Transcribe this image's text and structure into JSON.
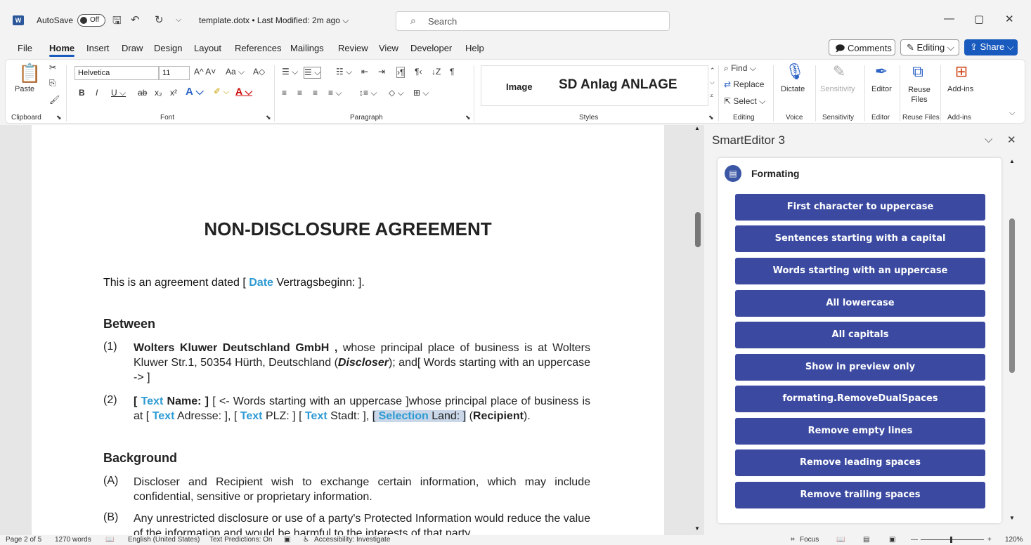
{
  "titlebar": {
    "autosave_label": "AutoSave",
    "autosave_state": "Off",
    "doc_title": "template.dotx • Last Modified: 2m ago ⌵",
    "search_placeholder": "Search"
  },
  "menu": {
    "tabs": [
      "File",
      "Home",
      "Insert",
      "Draw",
      "Design",
      "Layout",
      "References",
      "Mailings",
      "Review",
      "View",
      "Developer",
      "Help"
    ],
    "active": "Home",
    "comments_label": "Comments",
    "editing_label": "Editing ⌵",
    "share_label": "Share ⌵"
  },
  "ribbon": {
    "paste_label": "Paste",
    "clipboard_label": "Clipboard",
    "font_name": "Helvetica",
    "font_size": "11",
    "font_label": "Font",
    "paragraph_label": "Paragraph",
    "styles_label": "Styles",
    "style_image": "Image",
    "style_sd": "SD Anlag ANLAGE",
    "find_label": "Find ⌵",
    "replace_label": "Replace",
    "select_label": "Select ⌵",
    "editing_label": "Editing",
    "dictate_label": "Dictate",
    "voice_label": "Voice",
    "sensitivity_label": "Sensitivity",
    "sensitivity_group": "Sensitivity",
    "editor_label": "Editor",
    "editor_group": "Editor",
    "reuse_label": "Reuse Files",
    "reuse_group": "Reuse Files",
    "addins_label": "Add-ins",
    "addins_group": "Add-ins"
  },
  "document": {
    "heading": "NON-DISCLOSURE AGREEMENT",
    "intro_pre": "This is an agreement dated [ ",
    "intro_field": "Date",
    "intro_post": " Vertragsbeginn: ].",
    "between_heading": "Between",
    "item1_num": "(1)",
    "item1_bold": "Wolters Kluwer Deutschland GmbH ,",
    "item1_text": " whose principal place of business is at Wolters Kluwer Str.1, 50354 Hürth, Deutschland (",
    "item1_discloser": "Discloser",
    "item1_tail": "); and[  Words starting with an uppercase -> ]",
    "item2_num": "(2)",
    "item2_open": "[ ",
    "item2_text_field": "Text",
    "item2_name": " Name: ]",
    "item2_mid": " [  <- Words starting with an uppercase ]whose principal place of business is at [ ",
    "item2_adresse": " Adresse: ], [ ",
    "item2_plz": " PLZ: ] [ ",
    "item2_stadt": " Stadt: ], ",
    "item2_sel_open": "[ ",
    "item2_selection": "Selection",
    "item2_land": " Land: ]",
    "item2_recipient_pre": " (",
    "item2_recipient": "Recipient",
    "item2_recipient_post": ").",
    "background_heading": "Background",
    "itemA_num": "(A)",
    "itemA_text": "Discloser and Recipient wish to exchange certain information, which may include confidential, sensitive or proprietary information.",
    "itemB_num": "(B)",
    "itemB_text": "Any unrestricted disclosure or use of a party's Protected Information would reduce the value of the information and would be harmful to the interests of that party."
  },
  "pane": {
    "title": "SmartEditor 3",
    "card_title": "Formating",
    "buttons": [
      "First character to uppercase",
      "Sentences starting with a capital",
      "Words starting with an uppercase",
      "All lowercase",
      "All capitals",
      "Show in preview only",
      "formating.RemoveDualSpaces",
      "Remove empty lines",
      "Remove leading spaces",
      "Remove trailing spaces"
    ]
  },
  "status": {
    "page": "Page 2 of 5",
    "words": "1270 words",
    "language": "English (United States)",
    "predictions": "Text Predictions: On",
    "accessibility": "Accessibility: Investigate",
    "focus": "Focus",
    "zoom": "120%"
  }
}
